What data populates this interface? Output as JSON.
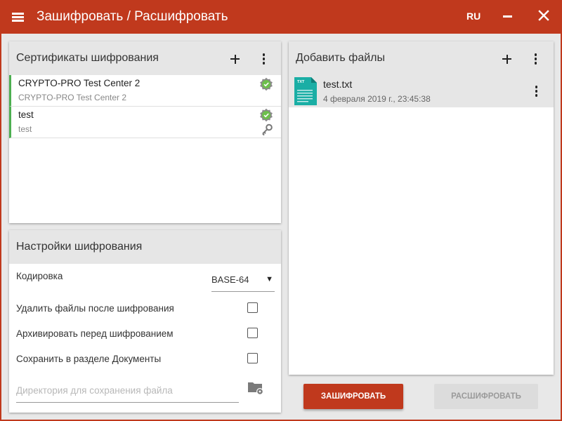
{
  "app": {
    "title": "Зашифровать / Расшифровать",
    "language": "RU",
    "accent_color": "#c0391d"
  },
  "certificates_panel": {
    "title": "Сертификаты шифрования",
    "add_icon": "plus-icon",
    "menu_icon": "more-vert-icon",
    "items": [
      {
        "name": "CRYPTO-PRO Test Center 2",
        "issuer": "CRYPTO-PRO Test Center 2",
        "status_icon": "check-badge-icon",
        "has_private_key": false
      },
      {
        "name": "test",
        "issuer": "test",
        "status_icon": "check-badge-icon",
        "has_private_key": true
      }
    ]
  },
  "settings_panel": {
    "title": "Настройки шифрования",
    "encoding_label": "Кодировка",
    "encoding_value": "BASE-64",
    "delete_after_label": "Удалить файлы после шифрования",
    "delete_after_checked": false,
    "archive_label": "Архивировать перед шифрованием",
    "archive_checked": false,
    "save_to_docs_label": "Сохранить в разделе Документы",
    "save_to_docs_checked": false,
    "directory_placeholder": "Директория для сохранения файла",
    "directory_value": ""
  },
  "files_panel": {
    "title": "Добавить файлы",
    "add_icon": "plus-icon",
    "menu_icon": "more-vert-icon",
    "files": [
      {
        "name": "test.txt",
        "date": "4 февраля 2019 г., 23:45:38",
        "type_label": "TXT"
      }
    ]
  },
  "actions": {
    "encrypt_label": "ЗАШИФРОВАТЬ",
    "decrypt_label": "РАСШИФРОВАТЬ",
    "decrypt_enabled": false
  }
}
